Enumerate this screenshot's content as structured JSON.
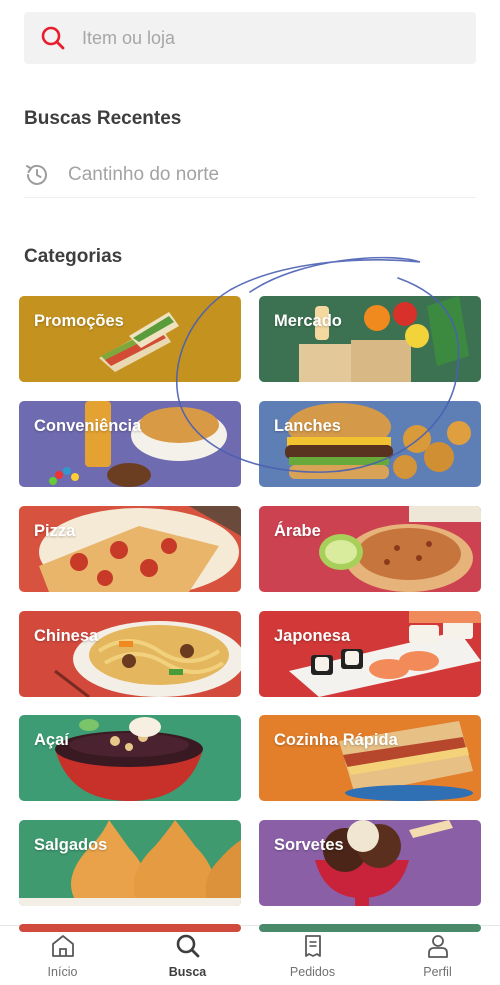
{
  "search": {
    "placeholder": "Item ou loja",
    "icon": "search-icon",
    "icon_color": "#ea1d2c"
  },
  "recent": {
    "title": "Buscas Recentes",
    "items": [
      {
        "label": "Cantinho do norte",
        "icon": "history-icon"
      }
    ]
  },
  "categories": {
    "title": "Categorias",
    "items": [
      {
        "label": "Promoções",
        "bg": "#c4931f"
      },
      {
        "label": "Mercado",
        "bg": "#3c7252"
      },
      {
        "label": "Conveniência",
        "bg": "#6f6bb0"
      },
      {
        "label": "Lanches",
        "bg": "#5e7fb5"
      },
      {
        "label": "Pizza",
        "bg": "#d7533f"
      },
      {
        "label": "Árabe",
        "bg": "#cd4251"
      },
      {
        "label": "Chinesa",
        "bg": "#d34a3d"
      },
      {
        "label": "Japonesa",
        "bg": "#d23838"
      },
      {
        "label": "Açaí",
        "bg": "#3d9c73"
      },
      {
        "label": "Cozinha Rápida",
        "bg": "#e37e2a"
      },
      {
        "label": "Salgados",
        "bg": "#3f9a70"
      },
      {
        "label": "Sorvetes",
        "bg": "#8a5fa6"
      }
    ]
  },
  "nav": {
    "items": [
      {
        "label": "Início",
        "icon": "home-icon",
        "active": false
      },
      {
        "label": "Busca",
        "icon": "search-icon",
        "active": true
      },
      {
        "label": "Pedidos",
        "icon": "orders-icon",
        "active": false
      },
      {
        "label": "Perfil",
        "icon": "profile-icon",
        "active": false
      }
    ]
  },
  "colors": {
    "brand_red": "#ea1d2c",
    "text_dark": "#3e3e3e",
    "text_muted": "#a3a3a3",
    "annotation_pen": "#4a5fb3"
  }
}
